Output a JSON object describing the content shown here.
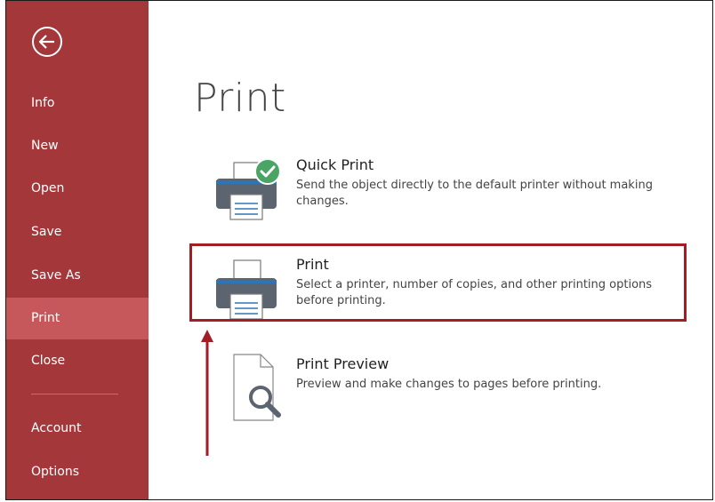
{
  "sidebar": {
    "back_icon": "back-arrow-circle-icon",
    "items": [
      {
        "label": "Info",
        "active": false
      },
      {
        "label": "New",
        "active": false
      },
      {
        "label": "Open",
        "active": false
      },
      {
        "label": "Save",
        "active": false
      },
      {
        "label": "Save As",
        "active": false
      },
      {
        "label": "Print",
        "active": true
      },
      {
        "label": "Close",
        "active": false
      },
      {
        "label": "Account",
        "active": false
      },
      {
        "label": "Options",
        "active": false
      }
    ]
  },
  "main": {
    "title": "Print",
    "options": [
      {
        "title": "Quick Print",
        "description": "Send the object directly to the default printer without making changes.",
        "icon": "quick-print-icon"
      },
      {
        "title": "Print",
        "description": "Select a printer, number of copies, and other printing options before printing.",
        "icon": "printer-icon",
        "highlighted": true
      },
      {
        "title": "Print Preview",
        "description": "Preview and make changes to pages before printing.",
        "icon": "print-preview-icon"
      }
    ]
  },
  "colors": {
    "sidebar_bg": "#a4373a",
    "sidebar_active": "#c6575b",
    "highlight": "#a31d24",
    "printer_body": "#5c6470",
    "printer_paper_accent": "#2e75b6",
    "check_green": "#4aa564"
  }
}
